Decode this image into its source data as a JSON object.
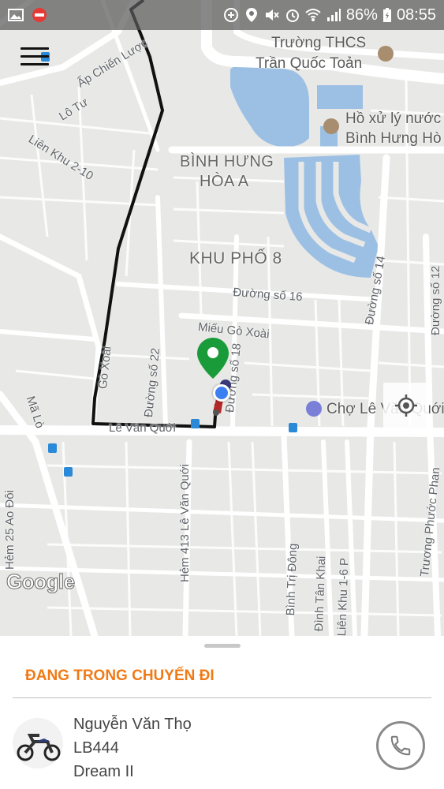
{
  "status_bar": {
    "battery": "86%",
    "time": "08:55"
  },
  "map": {
    "labels": {
      "school": "Trường THCS",
      "school2": "Trần Quốc Toản",
      "lake": "Hồ xử lý nước",
      "lake2": "Bình Hưng Hò",
      "ward": "BÌNH HƯNG",
      "ward2": "HÒA A",
      "area": "KHU PHỐ 8",
      "road_ap_chien_luoc": "Ấp Chiến Lược",
      "road_lo_tu": "Lô Tư",
      "road_lien_khu": "Liên Khu 2-10",
      "road_16": "Đường số 16",
      "road_14": "Đường số 14",
      "road_12": "Đường số 12",
      "mieu": "Miếu Gò Xoài",
      "road_22": "Đường số 22",
      "road_18": "Đường số 18",
      "go_xoai": "Gò Xoài",
      "ma_lo": "Mã Lò",
      "le_van_quoi": "Lê Văn Quới",
      "cho": "Chợ Lê Văn Quới",
      "hem_413": "Hẻm 413 Lê Văn Quới",
      "hem_25": "Hẻm 25 Ao Đôi",
      "binh_tri_dong": "Bình Trị Đông",
      "dinh_tan_khai": "Đình Tân Khai",
      "lien_khu_16": "Liên Khu 1-6 P",
      "truong_phuoc_phan": "Trương Phước Phan",
      "google": "Google"
    }
  },
  "sheet": {
    "trip_status": "ĐANG TRONG CHUYẾN ĐI",
    "driver": {
      "name": "Nguyễn Văn Thọ",
      "plate": "LB444",
      "vehicle": "Dream II"
    }
  },
  "colors": {
    "accent": "#f07a16",
    "pin": "#1a9b3a",
    "water": "#9cc0e4",
    "route": "#111111"
  }
}
